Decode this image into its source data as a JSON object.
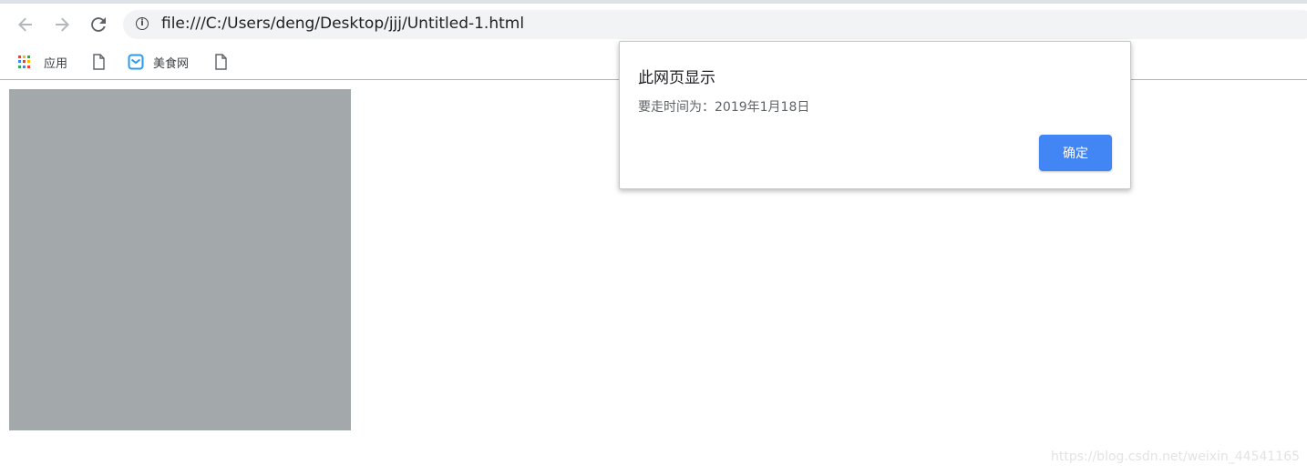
{
  "browser": {
    "url": "file:///C:/Users/deng/Desktop/jjj/Untitled-1.html",
    "nav": {
      "back_icon": "back-arrow-icon",
      "forward_icon": "forward-arrow-icon",
      "reload_icon": "reload-icon",
      "site_info_icon": "info-icon"
    },
    "bookmarks": [
      {
        "label": "应用",
        "icon": "apps-grid-icon"
      },
      {
        "label": "",
        "icon": "document-icon"
      },
      {
        "label": "美食网",
        "icon": "mail-icon"
      },
      {
        "label": "",
        "icon": "document-icon"
      }
    ]
  },
  "page": {
    "box_color": "#a3a8ab"
  },
  "alert": {
    "title": "此网页显示",
    "message": "要走时间为：2019年1月18日",
    "ok_label": "确定",
    "button_color": "#4285f4"
  },
  "watermark": "https://blog.csdn.net/weixin_44541165"
}
